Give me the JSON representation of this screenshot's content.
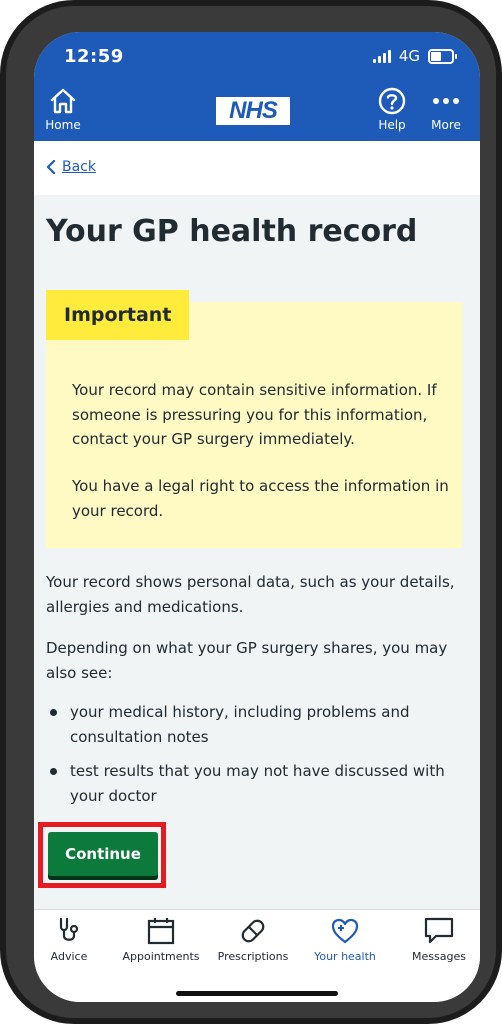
{
  "status": {
    "time": "12:59",
    "network": "4G"
  },
  "header": {
    "home_label": "Home",
    "logo_text": "NHS",
    "help_label": "Help",
    "more_label": "More"
  },
  "back": {
    "label": "Back"
  },
  "page": {
    "title": "Your GP health record",
    "warning_label": "Important",
    "warning_text_1": "Your record may contain sensitive information. If someone is pressuring you for this information, contact your GP surgery immediately.",
    "warning_text_2": "You have a legal right to access the information in your record.",
    "para_1": "Your record shows personal data, such as your details, allergies and medications.",
    "para_2": "Depending on what your GP surgery shares, you may also see:",
    "bullets": [
      "your medical history, including problems and consultation notes",
      "test results that you may not have discussed with your doctor"
    ],
    "continue_label": "Continue"
  },
  "tabs": [
    {
      "label": "Advice",
      "icon": "stethoscope-icon"
    },
    {
      "label": "Appointments",
      "icon": "calendar-icon"
    },
    {
      "label": "Prescriptions",
      "icon": "pill-icon"
    },
    {
      "label": "Your health",
      "icon": "heart-plus-icon",
      "active": true
    },
    {
      "label": "Messages",
      "icon": "message-icon"
    }
  ],
  "colors": {
    "nhs_blue": "#1e5bb8",
    "warning_bg": "#fff9c4",
    "warning_label_bg": "#ffeb3b",
    "button_green": "#0b7a3c",
    "highlight_red": "#e31b23"
  }
}
